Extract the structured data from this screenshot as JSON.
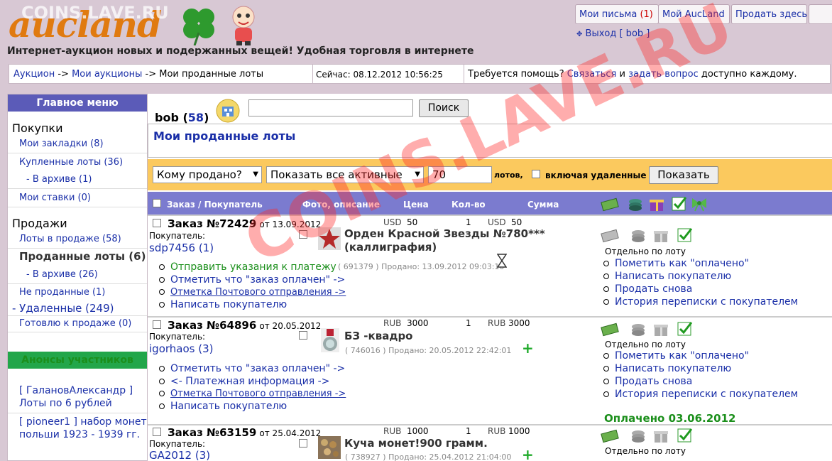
{
  "watermark_top": "COINS.LAVE.RU",
  "watermark_center": "COINS.LAVE.RU",
  "logo_text": "aucland",
  "tagline": "Интернет-аукцион новых и подержанных вещей! Удобная торговля в интернете",
  "top_buttons": {
    "messages_label": "Мои письма",
    "messages_count": "(1)",
    "my_aucland": "Мой AucLand",
    "sell_here": "Продать здесь"
  },
  "logout": "Выход [ bob ]",
  "breadcrumb": {
    "auction": "Аукцион",
    "arrow1": "->",
    "my_auctions": "Мои аукционы",
    "arrow2": "->",
    "current": "Мои проданные лоты",
    "now_label": "Сейчас: 08.12.2012 10:56:25",
    "help_q": "Требуется помощь?",
    "contact": "Связаться",
    "and": "и",
    "ask": "задать вопрос",
    "available": "доступно каждому."
  },
  "menu": {
    "header": "Главное меню",
    "purchases": "Покупки",
    "bookmarks": "Мои закладки (8)",
    "bought": "Купленные лоты (36)",
    "bought_archive": "- В архиве (1)",
    "bids": "Мои ставки (0)",
    "sales": "Продажи",
    "on_sale": "Лоты в продаже (58)",
    "sold": "Проданные лоты (6)",
    "sold_archive": "- В архиве (26)",
    "not_sold": "Не проданные (1)",
    "deleted": "- Удаленные (249)",
    "ready": "Готовлю к продаже (0)",
    "announce_header": "Анонсы участников",
    "announce1": "[ ГалановАлександр ] Лоты по 6 рублей",
    "announce2": "[ pioneer1 ] набор монет польши 1923 - 1939 гг."
  },
  "user": {
    "name": "bob",
    "rating": "58"
  },
  "search": {
    "value": "",
    "button": "Поиск"
  },
  "page_title": "Мои проданные лоты",
  "filters": {
    "buyer_select": "Кому продано?",
    "status_select": "Показать все активные",
    "count_value": "70",
    "lots_label": "лотов,",
    "include_deleted": "включая удаленные",
    "show_button": "Показать"
  },
  "table_header": {
    "order_buyer": "Заказ / Покупатель",
    "photo_desc": "Фото, описание",
    "price": "Цена",
    "qty": "Кол-во",
    "sum": "Сумма"
  },
  "orders": [
    {
      "title": "Заказ №72429",
      "date": "от 13.09.2012",
      "buyer_label": "Покупатель:",
      "buyer": "sdp7456",
      "buyer_rating": "(1)",
      "currency": "USD",
      "price": "50",
      "qty": "1",
      "sum_currency": "USD",
      "sum": "50",
      "lot_title": "Орден Красной Звезды №780*** (каллиграфия)",
      "lot_meta": "( 691379 ) Продано: 13.09.2012 09:03:10",
      "separately": "Отдельно по лоту",
      "actions_left": [
        "Отправить указания к платежу",
        "Отметить что \"заказ оплачен\" ->",
        "Отметка Почтового отправления ->",
        "Написать покупателю"
      ],
      "actions_right": [
        "Пометить как \"оплачено\"",
        "Написать покупателю",
        "Продать снова",
        "История переписки с покупателем"
      ]
    },
    {
      "title": "Заказ №64896",
      "date": "от 20.05.2012",
      "buyer_label": "Покупатель:",
      "buyer": "igorhaos",
      "buyer_rating": "(3)",
      "currency": "RUB",
      "price": "3000",
      "qty": "1",
      "sum_currency": "RUB",
      "sum": "3000",
      "lot_title": "БЗ -квадро",
      "lot_meta": "( 746016 ) Продано: 20.05.2012 22:42:01",
      "separately": "Отдельно по лоту",
      "actions_left": [
        "Отметить что \"заказ оплачен\" ->",
        "<- Платежная информация ->",
        "Отметка Почтового отправления ->",
        "Написать покупателю"
      ],
      "actions_right": [
        "Пометить как \"оплачено\"",
        "Написать покупателю",
        "Продать снова",
        "История переписки с покупателем"
      ],
      "paid": "Оплачено 03.06.2012"
    },
    {
      "title": "Заказ №63159",
      "date": "от 25.04.2012",
      "buyer_label": "Покупатель:",
      "buyer": "GA2012",
      "buyer_rating": "(3)",
      "currency": "RUB",
      "price": "1000",
      "qty": "1",
      "sum_currency": "RUB",
      "sum": "1000",
      "lot_title": "Куча монет!900 грамм.",
      "lot_meta": "( 738927 ) Продано: 25.04.2012 21:04:00",
      "separately": "Отдельно по лоту"
    }
  ],
  "colors": {
    "menu_header": "#5b5bb8",
    "announce_header": "#22a64a",
    "filter_bar": "#fbc95e",
    "table_header": "#7b7bcf",
    "link": "#1a2fa8",
    "logo": "#e07a10"
  }
}
